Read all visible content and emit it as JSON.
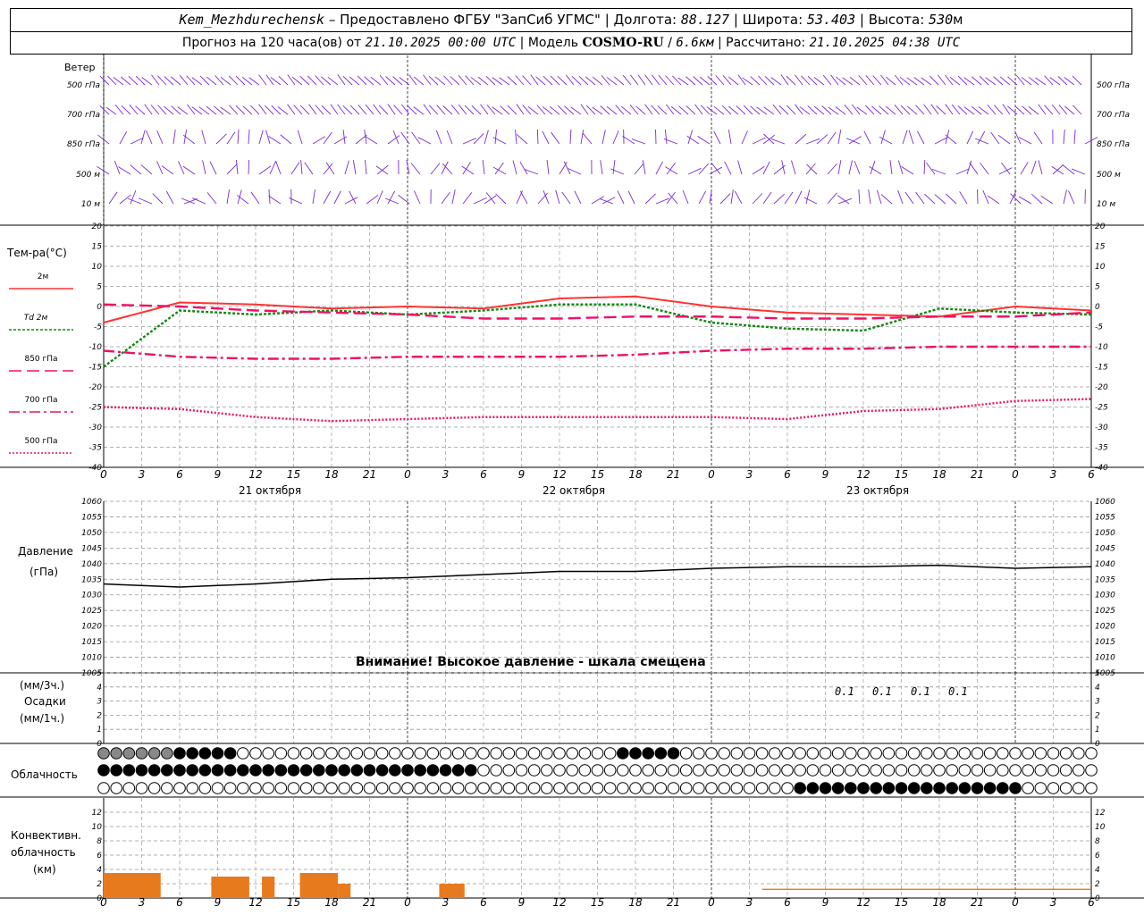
{
  "header": {
    "station": "Kem_Mezhdurechensk",
    "provider": "– Предоставлено ФГБУ \"ЗапСиб УГМС\"",
    "lon_label": "Долгота:",
    "lon": "88.127",
    "lat_label": "Широта:",
    "lat": "53.403",
    "alt_label": "Высота:",
    "alt": "530",
    "alt_unit": "м",
    "forecast_label": "Прогноз на 120 часа(ов) от",
    "forecast_start": "21.10.2025 00:00 UTC",
    "model_label": "Модель",
    "model": "COSMO-RU",
    "model_res": "6.6км",
    "calc_label": "Рассчитано:",
    "calc_time": "21.10.2025 04:38 UTC"
  },
  "wind_panel": {
    "title": "Ветер",
    "levels": [
      "500 гПа",
      "700 гПа",
      "850 гПа",
      "500 м",
      "10 м"
    ]
  },
  "temp_panel": {
    "title": "Тем-ра(°C)",
    "legend": [
      {
        "label": "2м",
        "color": "#ff3333",
        "dash": "solid"
      },
      {
        "label": "Td 2м",
        "color": "#118811",
        "dash": "dot"
      },
      {
        "label": "850 гПа",
        "color": "#ee1166",
        "dash": "longdash"
      },
      {
        "label": "700 гПа",
        "color": "#ee1166",
        "dash": "dashdot"
      },
      {
        "label": "500 гПа",
        "color": "#ee1166",
        "dash": "shortdot"
      }
    ]
  },
  "hour_labels": [
    "0",
    "3",
    "6",
    "9",
    "12",
    "15",
    "18",
    "21",
    "0",
    "3",
    "6",
    "9",
    "12",
    "15",
    "18",
    "21",
    "0",
    "3",
    "6",
    "9",
    "12",
    "15",
    "18",
    "21",
    "0",
    "3",
    "6"
  ],
  "day_labels": [
    "21 октября",
    "22 октября",
    "23 октября"
  ],
  "pressure_panel": {
    "title": "Давление",
    "unit": "(гПа)",
    "warning": "Внимание! Высокое давление - шкала смещена"
  },
  "precip_panel": {
    "unit_3h": "(мм/3ч.)",
    "title": "Осадки",
    "unit_1h": "(мм/1ч.)",
    "labels": [
      "0.1",
      "0.1",
      "0.1",
      "0.1"
    ]
  },
  "cloud_panel": {
    "title": "Облачность"
  },
  "conv_panel": {
    "title_1": "Конвективн.",
    "title_2": "облачность",
    "unit": "(км)"
  },
  "chart_data": {
    "type": "line",
    "x_hours": [
      0,
      6,
      12,
      18,
      24,
      30,
      36,
      42,
      48,
      54,
      60,
      66,
      72,
      78
    ],
    "temperature": {
      "ylim": [
        -40,
        20
      ],
      "ticks": [
        20,
        15,
        10,
        5,
        0,
        -5,
        -10,
        -15,
        -20,
        -25,
        -30,
        -35,
        -40
      ],
      "series": [
        {
          "name": "2м",
          "values": [
            -4,
            1,
            0.5,
            -0.5,
            0,
            -0.5,
            2,
            2.5,
            0,
            -1.5,
            -2,
            -2.5,
            0,
            -1
          ]
        },
        {
          "name": "Td 2м",
          "values": [
            -15,
            -1,
            -2,
            -1,
            -2,
            -1,
            0.5,
            0.5,
            -4,
            -5.5,
            -6,
            -0.5,
            -1.5,
            -2
          ]
        },
        {
          "name": "850 гПа",
          "values": [
            0.5,
            0,
            -1,
            -1.5,
            -2,
            -3,
            -3,
            -2.5,
            -2.5,
            -3,
            -3,
            -2.5,
            -2.5,
            -1.5
          ]
        },
        {
          "name": "700 гПа",
          "values": [
            -11,
            -12.5,
            -13,
            -13,
            -12.5,
            -12.5,
            -12.5,
            -12,
            -11,
            -10.5,
            -10.5,
            -10,
            -10,
            -10
          ]
        },
        {
          "name": "500 гПа",
          "values": [
            -25,
            -25.5,
            -27.5,
            -28.5,
            -28,
            -27.5,
            -27.5,
            -27.5,
            -27.5,
            -28,
            -26,
            -25.5,
            -23.5,
            -23
          ]
        }
      ]
    },
    "pressure": {
      "ylim": [
        1005,
        1060
      ],
      "ticks": [
        1060,
        1055,
        1050,
        1045,
        1040,
        1035,
        1030,
        1025,
        1020,
        1015,
        1010,
        1005
      ],
      "values": [
        1033.5,
        1032.5,
        1033.5,
        1035,
        1035.5,
        1036.5,
        1037.5,
        1037.5,
        1038.5,
        1039,
        1039,
        1039.5,
        1038.5,
        1039
      ]
    },
    "precip": {
      "ylim": [
        0,
        5
      ],
      "ticks": [
        5,
        4,
        3,
        2,
        1,
        0
      ]
    },
    "convective": {
      "ylim": [
        0,
        14
      ],
      "ticks": [
        12,
        10,
        8,
        6,
        4,
        2,
        0
      ]
    }
  }
}
